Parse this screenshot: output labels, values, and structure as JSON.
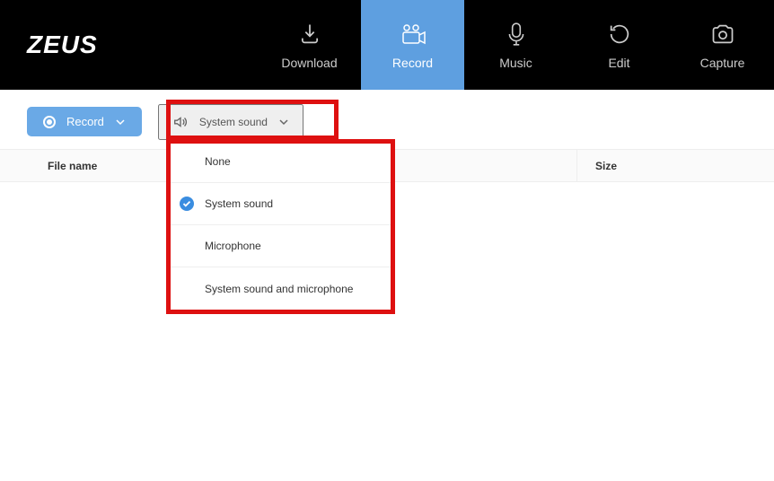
{
  "logo": "ZEUS",
  "nav_tabs": [
    {
      "label": "Download"
    },
    {
      "label": "Record"
    },
    {
      "label": "Music"
    },
    {
      "label": "Edit"
    },
    {
      "label": "Capture"
    }
  ],
  "toolbar": {
    "record_label": "Record",
    "sound_label": "System sound"
  },
  "dropdown_items": [
    {
      "label": "None",
      "checked": false
    },
    {
      "label": "System sound",
      "checked": true
    },
    {
      "label": "Microphone",
      "checked": false
    },
    {
      "label": "System sound and microphone",
      "checked": false
    }
  ],
  "columns": {
    "filename": "File name",
    "size": "Size"
  }
}
